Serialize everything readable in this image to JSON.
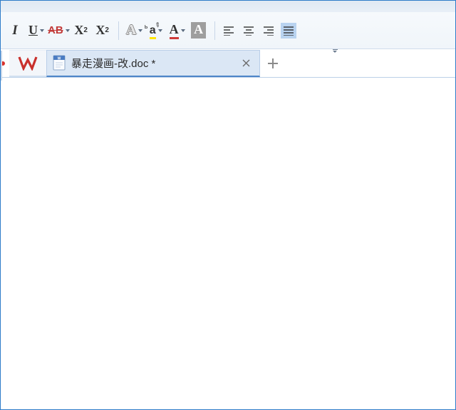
{
  "toolbar": {
    "sections": {
      "text_style": [
        {
          "id": "italic",
          "name": "italic-button"
        },
        {
          "id": "underline",
          "name": "underline-button"
        },
        {
          "id": "strikethrough",
          "name": "strikethrough-button"
        }
      ],
      "script": [
        {
          "id": "superscript",
          "name": "superscript-button"
        },
        {
          "id": "subscript",
          "name": "subscript-button"
        }
      ],
      "color": [
        {
          "id": "text-effects",
          "name": "text-effects-button"
        },
        {
          "id": "highlight",
          "name": "highlight-color-button"
        },
        {
          "id": "font-color",
          "name": "font-color-button"
        },
        {
          "id": "shading",
          "name": "shading-button"
        }
      ],
      "align": [
        {
          "id": "align-left",
          "name": "align-left-button",
          "selected": false
        },
        {
          "id": "align-center",
          "name": "align-center-button",
          "selected": false
        },
        {
          "id": "align-right",
          "name": "align-right-button",
          "selected": false
        },
        {
          "id": "align-justify",
          "name": "align-justify-button",
          "selected": true
        }
      ]
    },
    "colors": {
      "highlight": "#ffe600",
      "font": "#cf3a38",
      "strikethrough": "#c23a38"
    }
  },
  "tabs": {
    "active": {
      "filename": "暴走漫画-改.doc *",
      "modified": true,
      "type": "doc"
    },
    "add_label": "+"
  },
  "app": {
    "name": "WPS",
    "brand_color": "#c9302c"
  }
}
